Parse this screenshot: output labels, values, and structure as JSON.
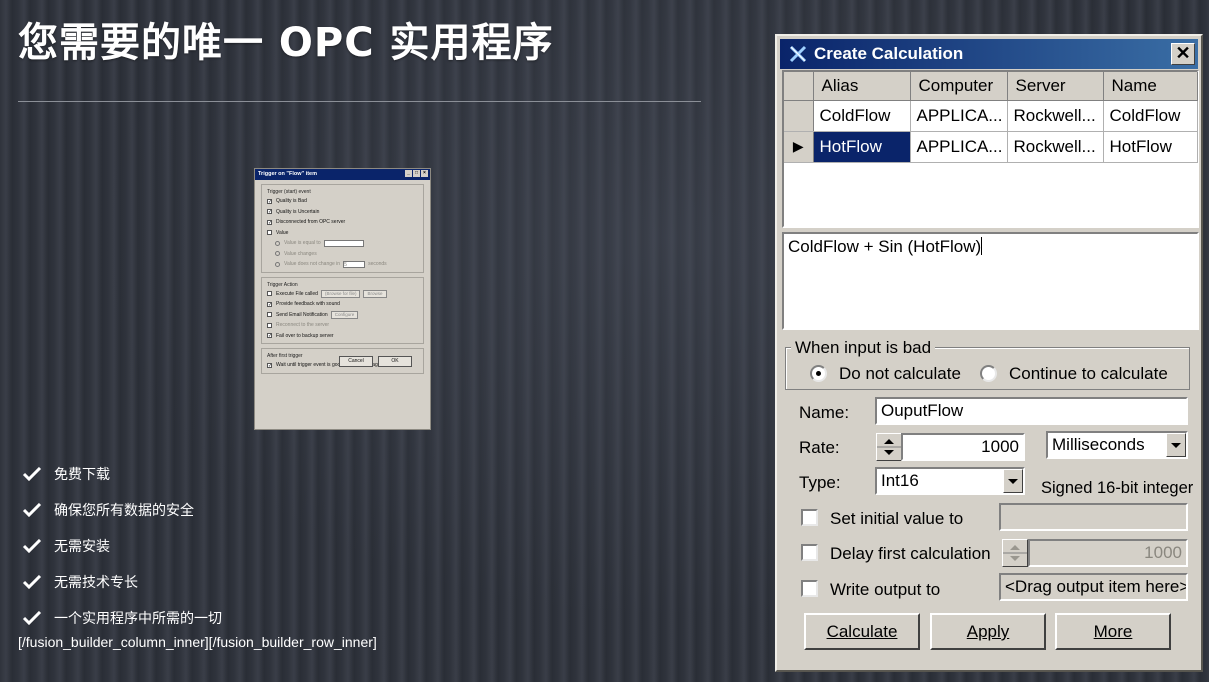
{
  "page": {
    "headline": "您需要的唯一 OPC 实用程序",
    "features": [
      "免费下载",
      "确保您所有数据的安全",
      "无需安装",
      "无需技术专长",
      "一个实用程序中所需的一切"
    ],
    "shortcode_text": "[/fusion_builder_column_inner][/fusion_builder_row_inner]"
  },
  "mini_dialog": {
    "title": "Trigger on \"Flow\" item",
    "start_event_title": "Trigger (start) event",
    "start_items": [
      {
        "label": "Quality is Bad",
        "checked": true
      },
      {
        "label": "Quality is Uncertain",
        "checked": true
      },
      {
        "label": "Disconnected from OPC server",
        "checked": true
      },
      {
        "label": "Value",
        "checked": false
      }
    ],
    "value_options": [
      "Value is equal to",
      "Value changes",
      "Value does not change in"
    ],
    "seconds_value": "5",
    "seconds_label": "seconds",
    "action_title": "Trigger Action",
    "action_items": [
      {
        "label": "Execute File called",
        "checked": false
      },
      {
        "label": "Provide feedback with sound",
        "checked": true
      },
      {
        "label": "Send Email Notification",
        "checked": false
      },
      {
        "label": "Reconnect to the server",
        "checked": false
      },
      {
        "label": "Fail over to backup server",
        "checked": true
      }
    ],
    "browse_placeholder": "(Browse for file)",
    "browse_label": "Browse",
    "configure_label": "Configure",
    "after_title": "After first trigger",
    "after_item": {
      "label": "Wait until trigger event is good before firing again",
      "checked": true
    },
    "cancel_label": "Cancel",
    "ok_label": "OK"
  },
  "dialog": {
    "title": "Create Calculation",
    "close_glyph": "✕",
    "grid": {
      "columns": [
        "Alias",
        "Computer",
        "Server",
        "Name"
      ],
      "rows": [
        {
          "alias": "ColdFlow",
          "computer": "APPLICA...",
          "server": "Rockwell...",
          "name": "ColdFlow",
          "current": false
        },
        {
          "alias": "HotFlow",
          "computer": "APPLICA...",
          "server": "Rockwell...",
          "name": "HotFlow",
          "current": true
        }
      ],
      "row_pointer": "▶"
    },
    "formula": "ColdFlow + Sin (HotFlow)",
    "bad_input": {
      "title": "When input is bad",
      "option_do_not": "Do not calculate",
      "option_continue": "Continue to calculate",
      "selected": "Do not calculate"
    },
    "name_label": "Name:",
    "name_value": "OuputFlow",
    "rate_label": "Rate:",
    "rate_value": "1000",
    "rate_unit": "Milliseconds",
    "type_label": "Type:",
    "type_value": "Int16",
    "type_description": "Signed 16-bit integer",
    "set_initial_label": "Set initial value to",
    "set_initial_checked": false,
    "delay_label": "Delay first calculation",
    "delay_checked": false,
    "delay_value": "1000",
    "write_label": "Write output to",
    "write_checked": false,
    "write_target": "<Drag output item here>",
    "buttons": {
      "calculate": "Calculate",
      "apply": "Apply",
      "more": "More"
    }
  },
  "colors": {
    "titlebar": "#0a246a",
    "selection": "#0a246a",
    "dialog_face": "#d4d0c8"
  }
}
